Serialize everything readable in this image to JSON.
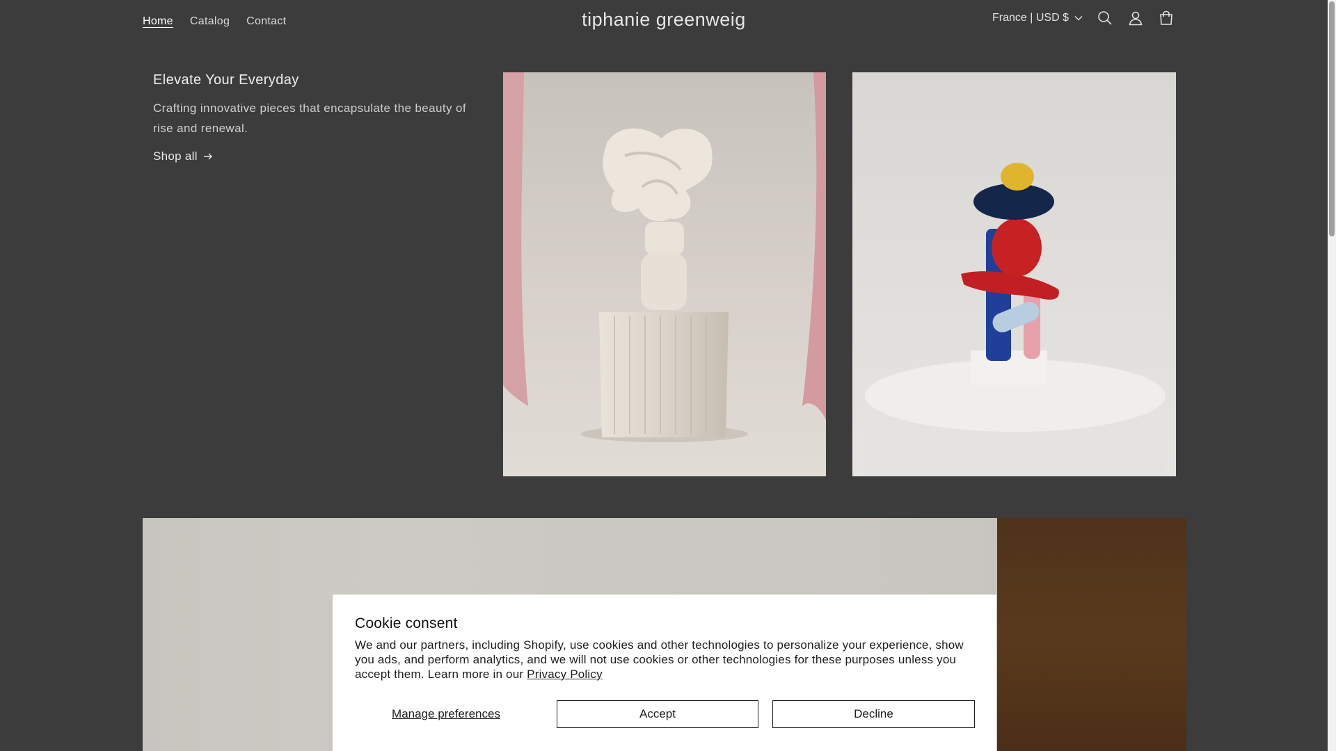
{
  "header": {
    "nav": [
      {
        "label": "Home",
        "active": true
      },
      {
        "label": "Catalog",
        "active": false
      },
      {
        "label": "Contact",
        "active": false
      }
    ],
    "brand": "tiphanie greenweig",
    "locale": "France | USD $",
    "icons": [
      "search-icon",
      "account-icon",
      "cart-icon"
    ]
  },
  "hero": {
    "title": "Elevate Your Everyday",
    "description": "Crafting innovative pieces that encapsulate the beauty of rise and renewal.",
    "link_label": "Shop all"
  },
  "cookie": {
    "title": "Cookie consent",
    "text": "We and our partners, including Shopify, use cookies and other technologies to personalize your experience, show you ads, and perform analytics, and we will not use cookies or other technologies for these purposes unless you accept them. Learn more in our",
    "link": "Privacy Policy",
    "manage_label": "Manage preferences",
    "accept_label": "Accept",
    "decline_label": "Decline"
  },
  "colors": {
    "background": "#3c3c3c",
    "cookie_bg": "#ffffff"
  }
}
